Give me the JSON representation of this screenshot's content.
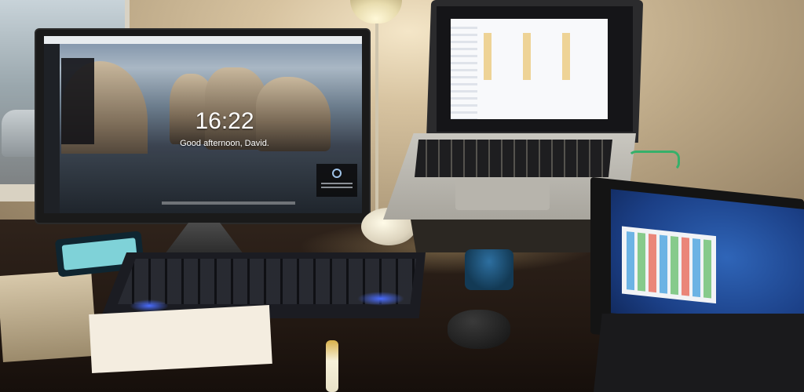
{
  "scene": {
    "monitor": {
      "lock_screen": {
        "time": "16:22",
        "greeting": "Good afternoon, David."
      }
    }
  },
  "icons": [
    "clock-widget-icon",
    "windows-start-icon",
    "folder-icon"
  ],
  "colors": {
    "keyboard_backlight": "#4a6dff",
    "tablet_wallpaper": "#1b3f86",
    "laptop_window": "#f8f9fb",
    "lamp_light": "#fff8d8"
  }
}
